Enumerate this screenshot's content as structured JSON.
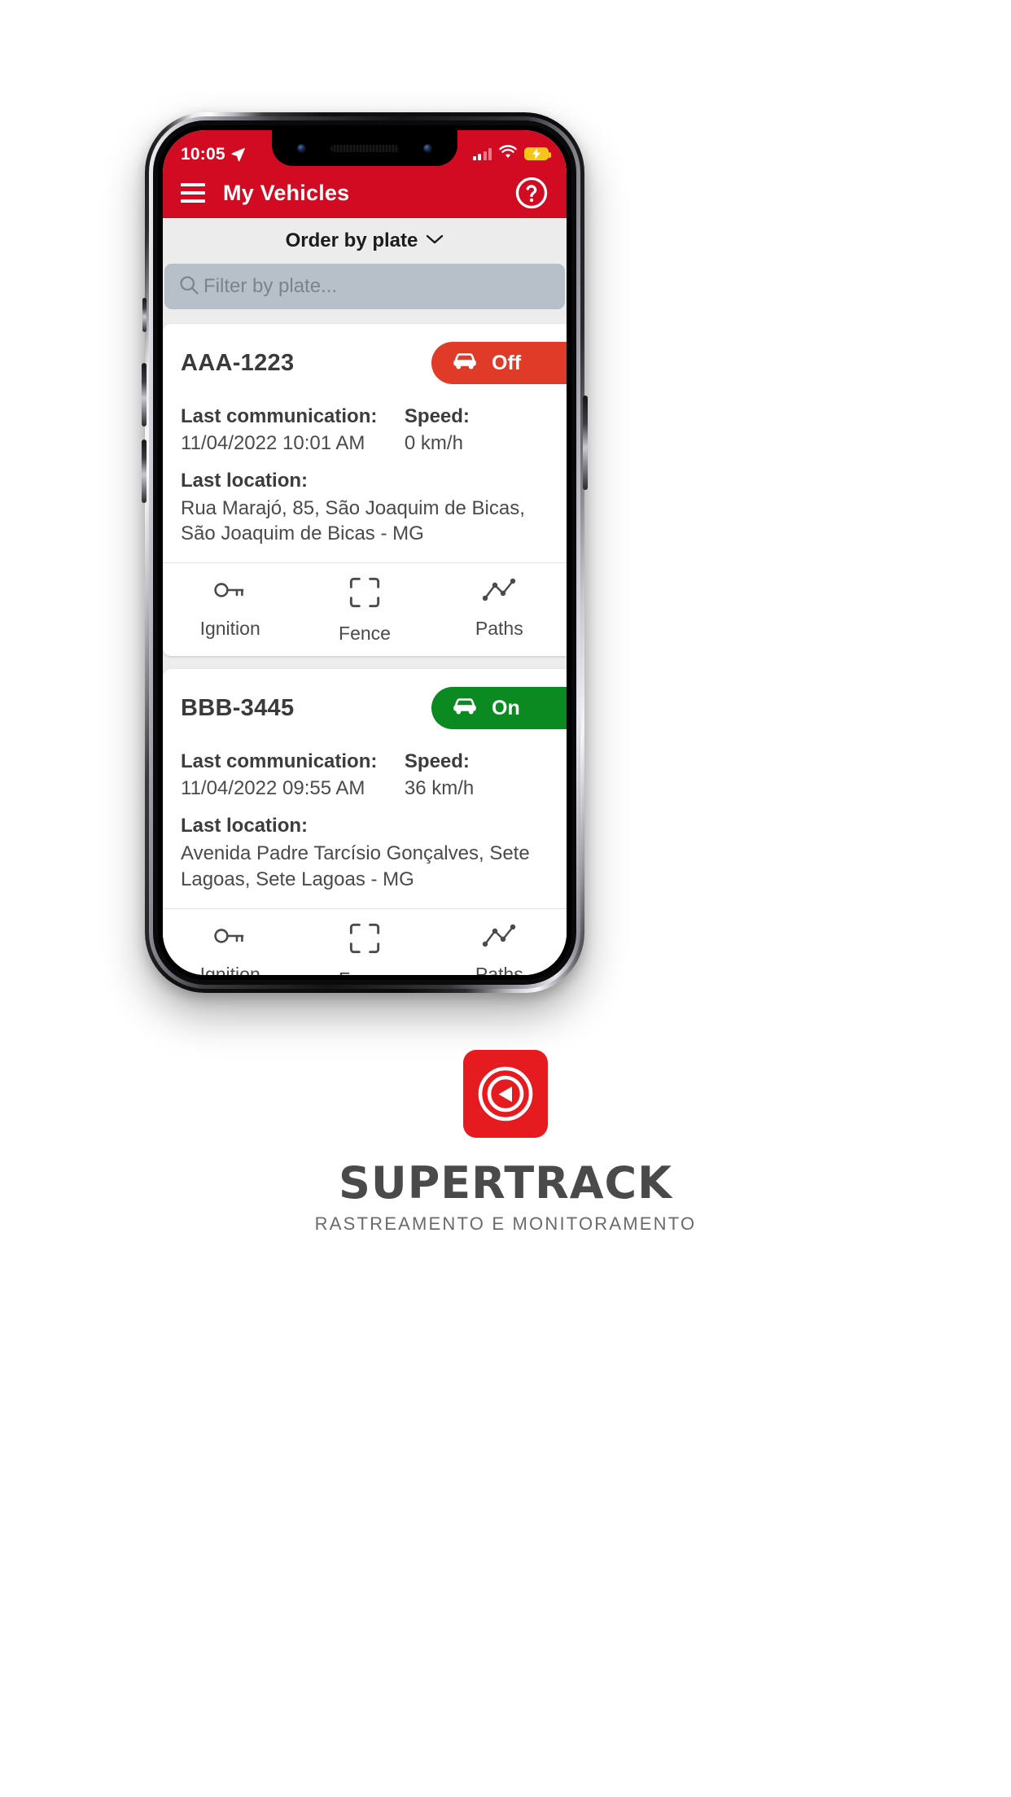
{
  "statusbar": {
    "time": "10:05",
    "location_icon": "location-arrow-icon",
    "signal_icon": "cellular-signal-icon",
    "wifi_icon": "wifi-icon",
    "battery_icon": "battery-charging-icon",
    "battery_color": "#F5C518"
  },
  "appbar": {
    "menu_icon": "hamburger-menu-icon",
    "title": "My Vehicles",
    "help_icon": "help-circle-icon",
    "background": "#D10B21"
  },
  "sortbar": {
    "label": "Order by plate",
    "chevron_icon": "chevron-down-icon"
  },
  "filter": {
    "placeholder": "Filter by plate...",
    "value": "",
    "search_icon": "search-icon"
  },
  "actions": [
    {
      "label": "Ignition",
      "icon": "key-icon"
    },
    {
      "label": "Fence",
      "icon": "fence-brackets-icon"
    },
    {
      "label": "Paths",
      "icon": "paths-line-chart-icon"
    }
  ],
  "labels": {
    "last_communication": "Last communication:",
    "speed": "Speed:",
    "last_location": "Last location:"
  },
  "vehicles": [
    {
      "plate": "AAA-1223",
      "status": "Off",
      "status_color": "#E03A28",
      "status_icon": "car-icon",
      "last_communication": "11/04/2022 10:01 AM",
      "speed": "0 km/h",
      "last_location": "Rua Marajó, 85, São Joaquim de Bicas, São Joaquim de Bicas - MG"
    },
    {
      "plate": "BBB-3445",
      "status": "On",
      "status_color": "#0A8A20",
      "status_icon": "car-icon",
      "last_communication": "11/04/2022 09:55 AM",
      "speed": "36 km/h",
      "last_location": "Avenida Padre Tarcísio Gonçalves, Sete Lagoas, Sete Lagoas - MG"
    }
  ],
  "logo": {
    "wordmark": "SUPERTRACK",
    "tagline": "RASTREAMENTO E MONITORAMENTO",
    "mark_icon": "supertrack-radar-icon",
    "mark_color": "#E51B20"
  }
}
